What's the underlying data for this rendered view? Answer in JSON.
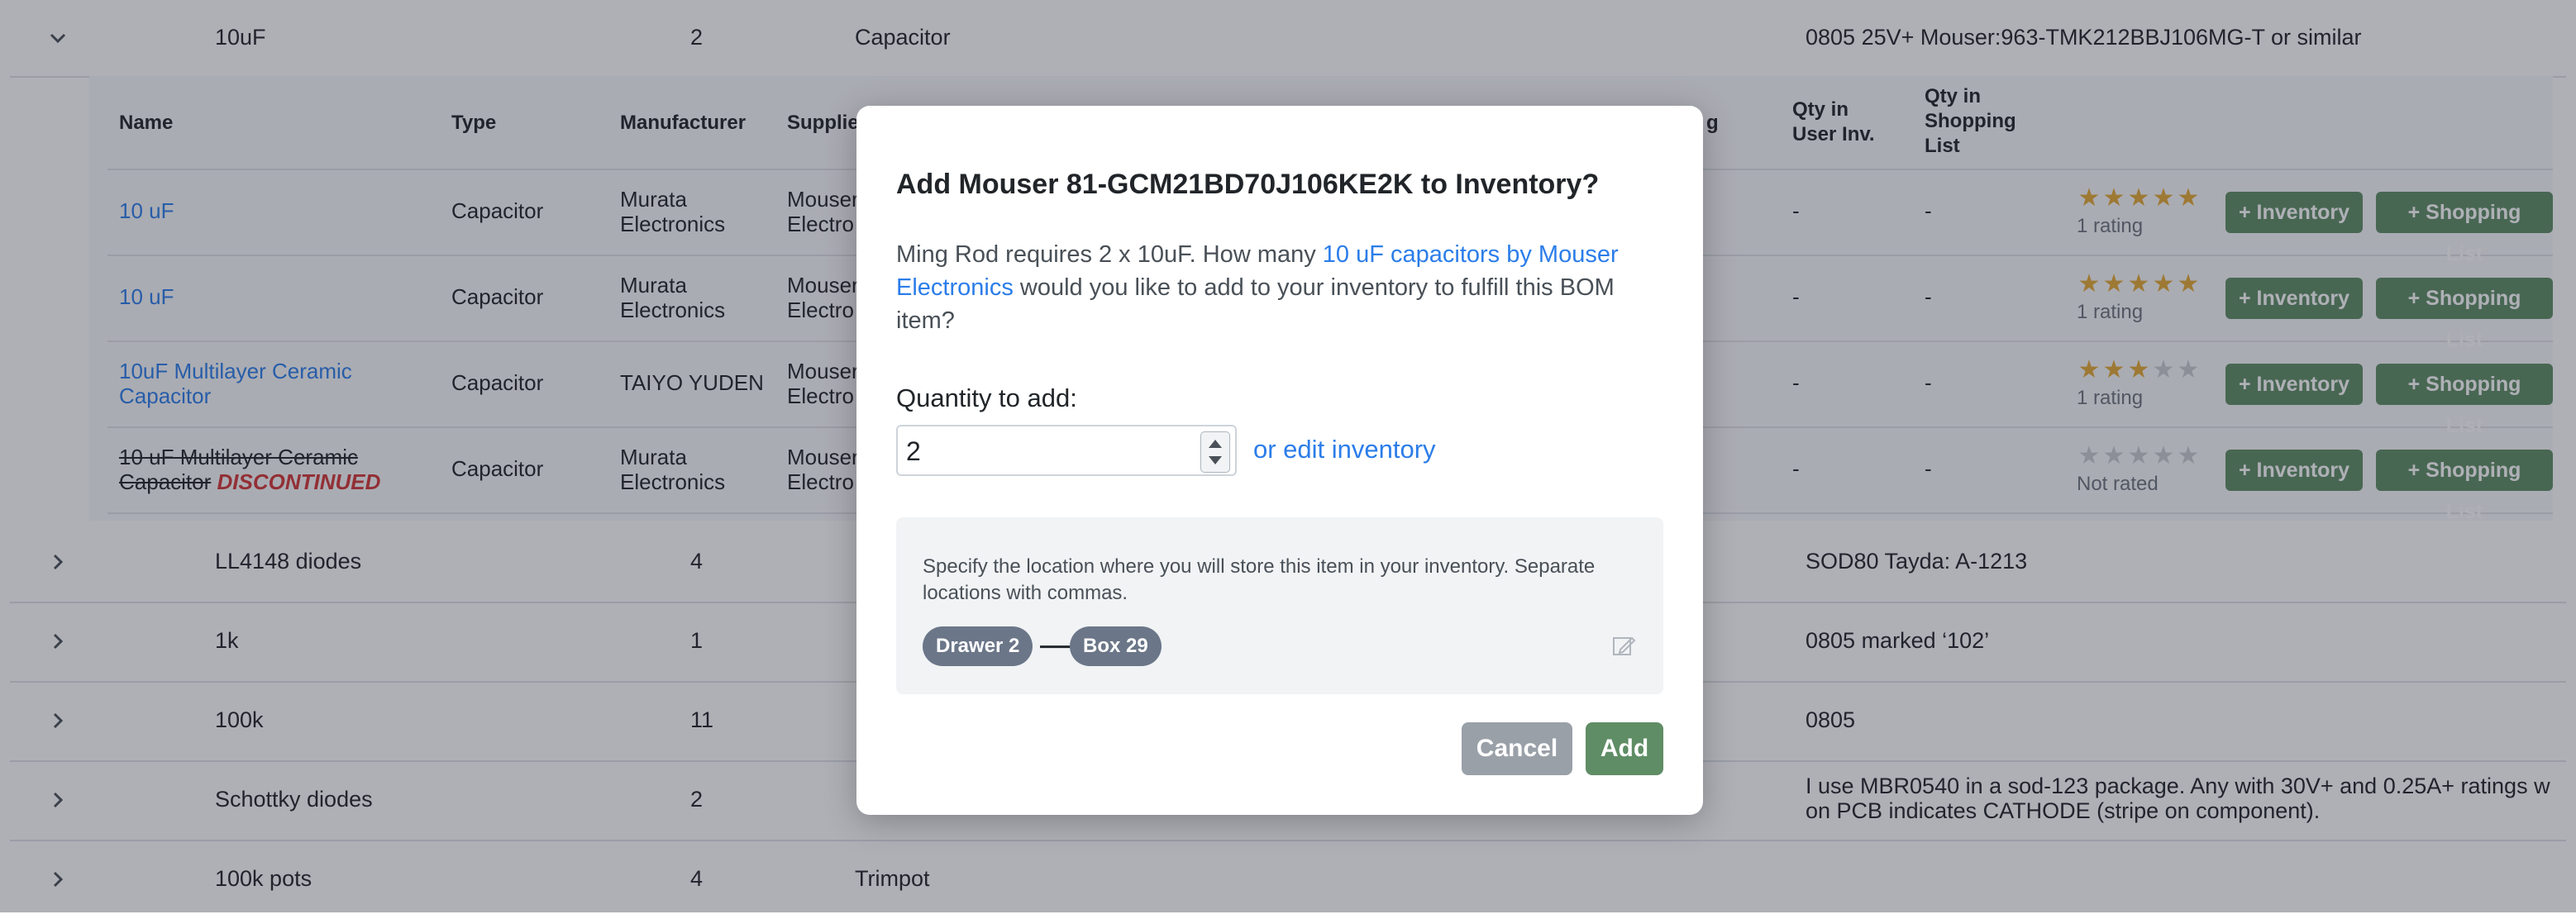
{
  "bom_rows": [
    {
      "name": "10uF",
      "qty": "2",
      "type": "Capacitor",
      "notes": "0805 25V+ Mouser:963-TMK212BBJ106MG-T or similar",
      "expanded": true
    },
    {
      "name": "LL4148 diodes",
      "qty": "4",
      "type": "",
      "notes": "SOD80 Tayda: A-1213"
    },
    {
      "name": "1k",
      "qty": "1",
      "type": "",
      "notes": "0805 marked ‘102’"
    },
    {
      "name": "100k",
      "qty": "11",
      "type": "",
      "notes": "0805"
    },
    {
      "name": "Schottky diodes",
      "qty": "2",
      "type": "",
      "notes": "I use MBR0540 in a sod-123 package. Any with 30V+ and 0.25A+ ratings w",
      "notes2": "on PCB indicates CATHODE (stripe on component)."
    },
    {
      "name": "100k pots",
      "qty": "4",
      "type": "Trimpot",
      "notes": ""
    }
  ],
  "sub_table": {
    "headers": {
      "name": "Name",
      "type": "Type",
      "manufacturer": "Manufacturer",
      "supplier": "Supplie",
      "g": "g",
      "qty_user": "Qty in\nUser Inv.",
      "qty_shop": "Qty in\nShopping\nList"
    },
    "rows": [
      {
        "name_l1": "10 uF",
        "name_l2": "",
        "type": "Capacitor",
        "mfr_l1": "Murata",
        "mfr_l2": "Electronics",
        "sup_l1": "Mouser",
        "sup_l2": "Electro",
        "qty_user": "-",
        "qty_shop": "-",
        "stars": 5,
        "rating": "1 rating",
        "discontinued": ""
      },
      {
        "name_l1": "10 uF",
        "name_l2": "",
        "type": "Capacitor",
        "mfr_l1": "Murata",
        "mfr_l2": "Electronics",
        "sup_l1": "Mouser",
        "sup_l2": "Electro",
        "qty_user": "-",
        "qty_shop": "-",
        "stars": 5,
        "rating": "1 rating",
        "discontinued": ""
      },
      {
        "name_l1": "10uF Multilayer Ceramic",
        "name_l2": "Capacitor",
        "type": "Capacitor",
        "mfr_l1": "TAIYO YUDEN",
        "mfr_l2": "",
        "sup_l1": "Mouser",
        "sup_l2": "Electro",
        "qty_user": "-",
        "qty_shop": "-",
        "stars": 3,
        "rating": "1 rating",
        "discontinued": ""
      },
      {
        "name_l1": "10 uF Multilayer Ceramic",
        "name_l2": "Capacitor",
        "type": "Capacitor",
        "mfr_l1": "Murata",
        "mfr_l2": "Electronics",
        "sup_l1": "Mouser",
        "sup_l2": "Electro",
        "qty_user": "-",
        "qty_shop": "-",
        "stars": 0,
        "rating": "Not rated",
        "discontinued": "DISCONTINUED"
      }
    ],
    "inventory_btn": "+ Inventory",
    "shopping_btn": "+ Shopping List"
  },
  "modal": {
    "title": "Add Mouser 81-GCM21BD70J106KE2K to Inventory?",
    "text_before": "Ming Rod requires 2 x 10uF. How many ",
    "text_link": "10 uF capacitors by Mouser Electronics",
    "text_after": " would you like to add to your inventory to fulfill this BOM item?",
    "qty_label": "Quantity to add:",
    "qty_value": "2",
    "edit_link": "or edit inventory",
    "location_help": "Specify the location where you will store this item in your inventory. Separate locations with commas.",
    "locations": [
      "Drawer 2",
      "Box 29"
    ],
    "cancel": "Cancel",
    "add": "Add"
  },
  "colors": {
    "accent": "#5f8d65",
    "link": "#2b7de9",
    "danger": "#d23636",
    "star": "#e3a934"
  }
}
